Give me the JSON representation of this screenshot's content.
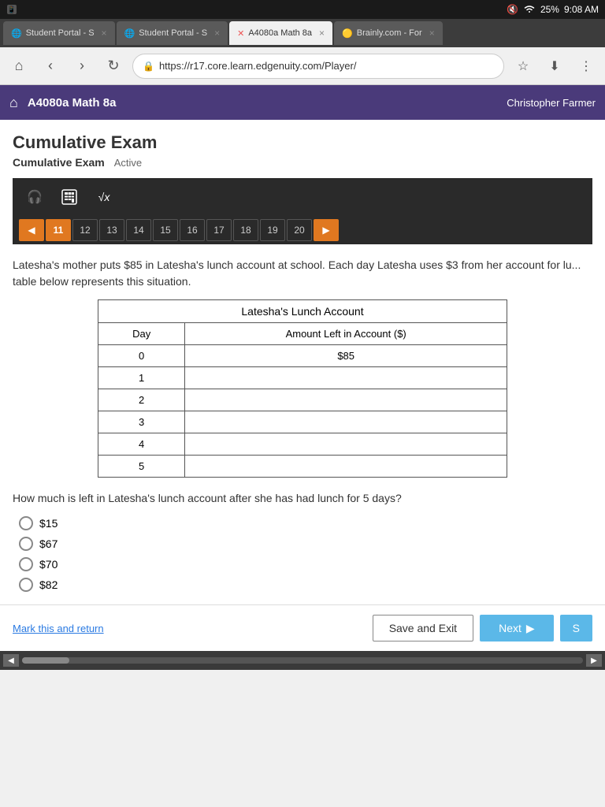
{
  "statusBar": {
    "mute_icon": "🔇",
    "wifi_icon": "📶",
    "battery": "25%",
    "time": "9:08 AM"
  },
  "tabs": [
    {
      "id": "tab1",
      "label": "Student Portal - S",
      "favicon": "🌐",
      "active": false
    },
    {
      "id": "tab2",
      "label": "Student Portal - S",
      "favicon": "🌐",
      "active": false
    },
    {
      "id": "tab3",
      "label": "A4080a Math 8a",
      "favicon": "×",
      "active": true
    },
    {
      "id": "tab4",
      "label": "Brainly.com - For",
      "favicon": "🟡",
      "active": false
    }
  ],
  "browser": {
    "url": "https://r17.core.learn.edgenuity.com/Player/",
    "back_label": "‹",
    "forward_label": "›",
    "reload_label": "↻",
    "home_label": "⌂",
    "bookmark_label": "☆",
    "download_label": "⬇",
    "menu_label": "⋮"
  },
  "appHeader": {
    "home_icon": "⌂",
    "title": "A4080a Math 8a",
    "user": "Christopher Farmer"
  },
  "pageTitle": "Cumulative Exam",
  "breadcrumb": {
    "label": "Cumulative Exam",
    "status": "Active"
  },
  "toolbar": {
    "audio_icon": "🎧",
    "calc_icon": "▦",
    "formula_icon": "√x"
  },
  "pagination": {
    "prev_arrow": "◀",
    "next_arrow": "▶",
    "pages": [
      "11",
      "12",
      "13",
      "14",
      "15",
      "16",
      "17",
      "18",
      "19",
      "20"
    ],
    "active_page": "11"
  },
  "question": {
    "text": "Latesha's mother puts $85 in Latesha's lunch account at school. Each day Latesha uses $3 from her account for lu... table below represents this situation.",
    "table_title": "Latesha's Lunch Account",
    "table_col1": "Day",
    "table_col2": "Amount Left in Account ($)",
    "table_rows": [
      {
        "day": "0",
        "amount": "$85"
      },
      {
        "day": "1",
        "amount": ""
      },
      {
        "day": "2",
        "amount": ""
      },
      {
        "day": "3",
        "amount": ""
      },
      {
        "day": "4",
        "amount": ""
      },
      {
        "day": "5",
        "amount": ""
      }
    ],
    "answer_question": "How much is left in Latesha's lunch account after she has had lunch for 5 days?",
    "options": [
      {
        "id": "opt1",
        "label": "$15"
      },
      {
        "id": "opt2",
        "label": "$67"
      },
      {
        "id": "opt3",
        "label": "$70"
      },
      {
        "id": "opt4",
        "label": "$82"
      }
    ]
  },
  "bottomBar": {
    "mark_label": "Mark this and return",
    "save_exit_label": "Save and Exit",
    "next_label": "Next",
    "next_arrow": "▶",
    "submit_label": "S"
  }
}
